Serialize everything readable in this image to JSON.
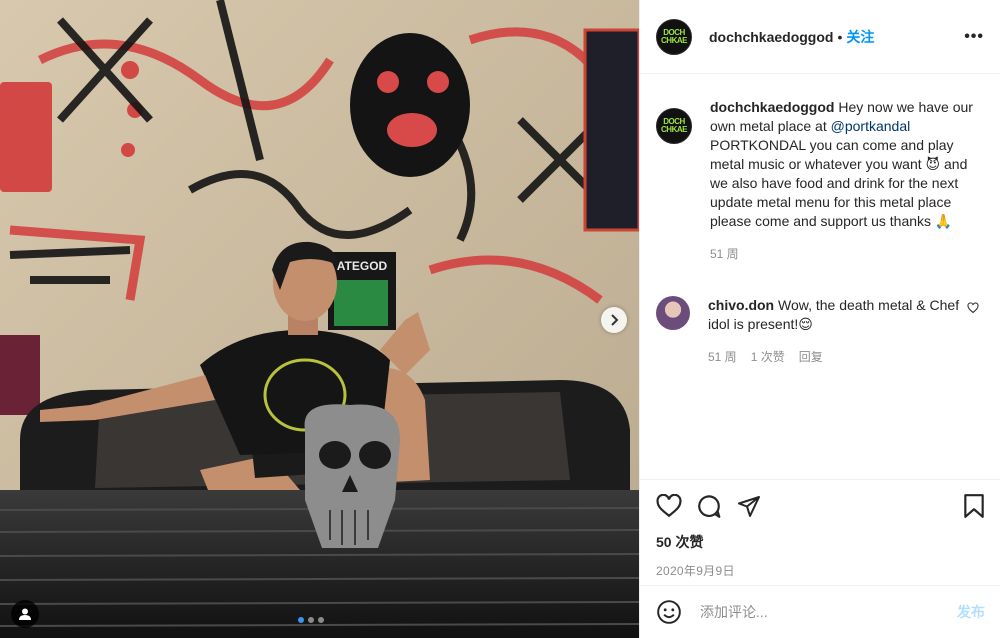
{
  "post": {
    "author": "dochchkaedoggod",
    "separator": "•",
    "follow_label": "关注",
    "more_label": "•••",
    "avatar_text": "DOCH CHKAE"
  },
  "caption": {
    "username": "dochchkaedoggod",
    "text_before_mention": " Hey now we have our own metal place at ",
    "mention": "@portkandal",
    "text_after_mention": " PORTKONDAL you can come and play metal music or whatever you want 😈 and we also have food and drink for the next update metal menu for this metal place please come and support us thanks 🙏",
    "time": "51 周"
  },
  "reply": {
    "username": "chivo.don",
    "text": " Wow, the death metal & Chef idol is present!😌",
    "time": "51 周",
    "likes": "1 次赞",
    "reply_label": "回复"
  },
  "actions": {
    "likes": "50 次赞",
    "date": "2020年9月9日"
  },
  "comment_box": {
    "placeholder": "添加评论...",
    "post_label": "发布"
  },
  "photo": {
    "sign_text": "ATEGOD"
  },
  "colors": {
    "accent": "#0095f6",
    "text": "#262626",
    "muted": "#8e8e8e",
    "post_disabled": "#b2dffc"
  }
}
